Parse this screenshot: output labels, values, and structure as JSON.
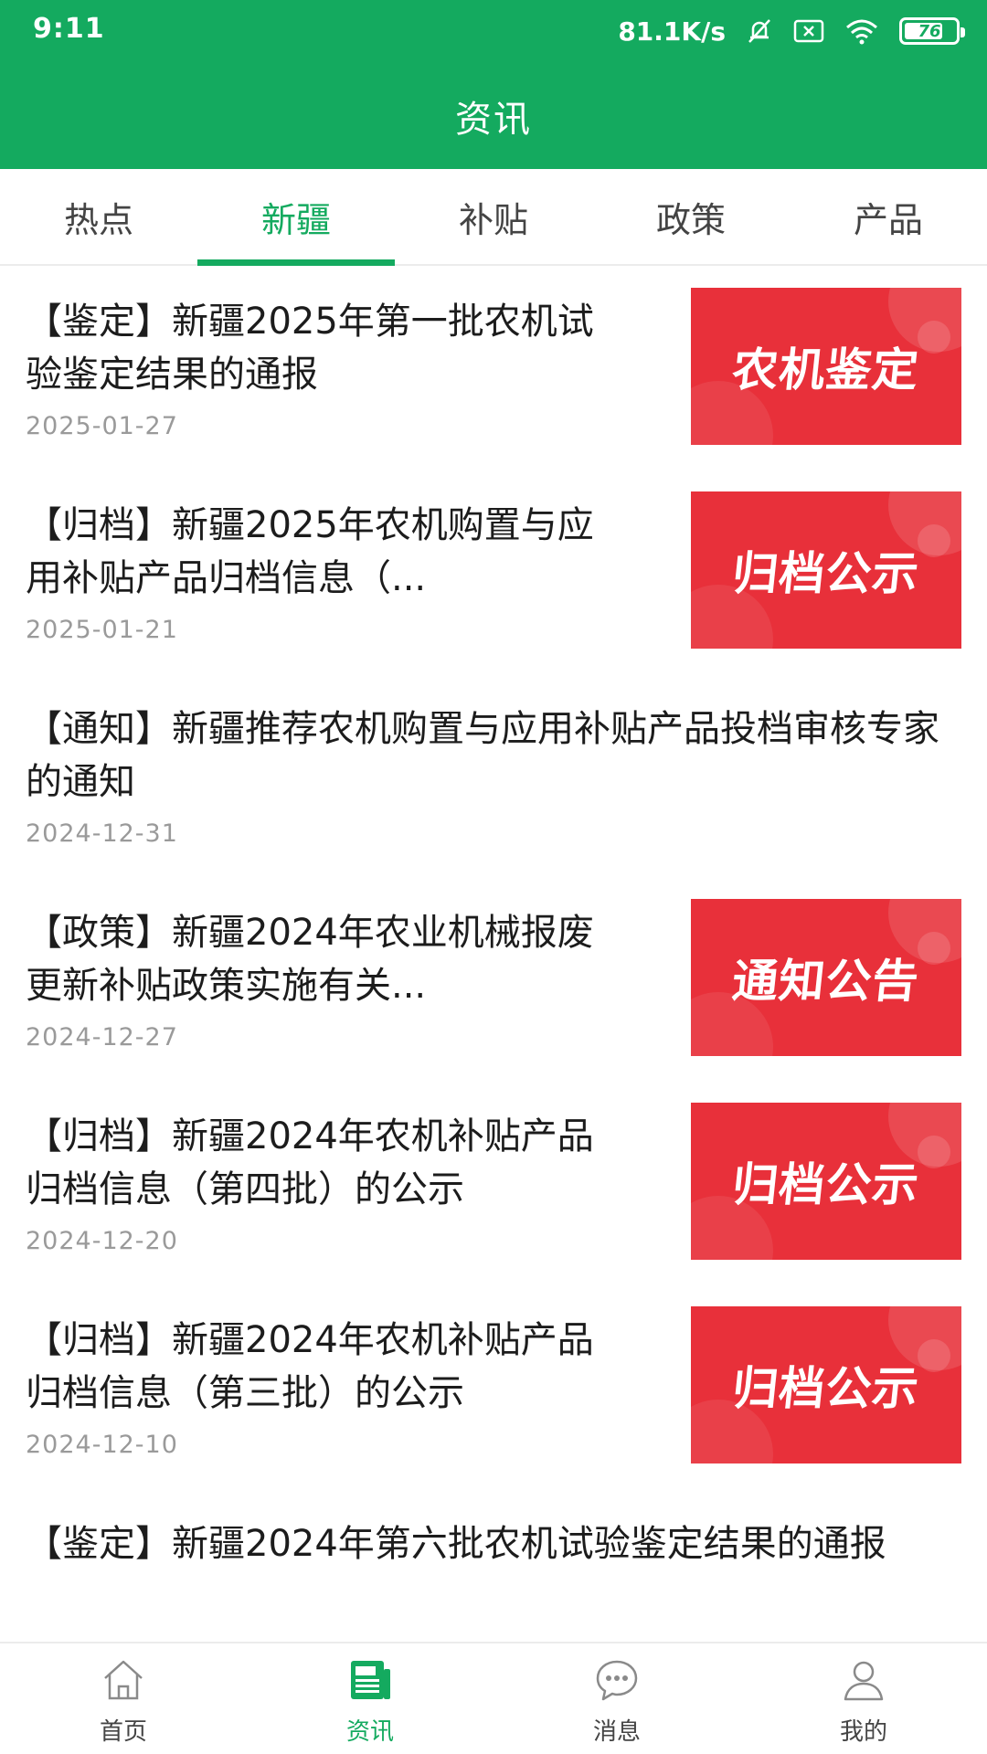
{
  "status_bar": {
    "time": "9:11",
    "network_speed": "81.1K/s",
    "battery_level": "76",
    "battery_fraction": 0.76,
    "icons": [
      "mute-icon",
      "sim-icon",
      "wifi-icon",
      "battery-icon"
    ]
  },
  "header": {
    "title": "资讯"
  },
  "tabs": [
    {
      "label": "热点",
      "active": false
    },
    {
      "label": "新疆",
      "active": true
    },
    {
      "label": "补贴",
      "active": false
    },
    {
      "label": "政策",
      "active": false
    },
    {
      "label": "产品",
      "active": false
    }
  ],
  "news": [
    {
      "title": "【鉴定】新疆2025年第一批农机试验鉴定结果的通报",
      "date": "2025-01-27",
      "thumbnail_text": "农机鉴定"
    },
    {
      "title": "【归档】新疆2025年农机购置与应用补贴产品归档信息（...",
      "date": "2025-01-21",
      "thumbnail_text": "归档公示"
    },
    {
      "title": "【通知】新疆推荐农机购置与应用补贴产品投档审核专家的通知",
      "date": "2024-12-31",
      "thumbnail_text": ""
    },
    {
      "title": "【政策】新疆2024年农业机械报废更新补贴政策实施有关...",
      "date": "2024-12-27",
      "thumbnail_text": "通知公告"
    },
    {
      "title": "【归档】新疆2024年农机补贴产品归档信息（第四批）的公示",
      "date": "2024-12-20",
      "thumbnail_text": "归档公示"
    },
    {
      "title": "【归档】新疆2024年农机补贴产品归档信息（第三批）的公示",
      "date": "2024-12-10",
      "thumbnail_text": "归档公示"
    },
    {
      "title": "【鉴定】新疆2024年第六批农机试验鉴定结果的通报",
      "date": "",
      "thumbnail_text": ""
    }
  ],
  "bottom_nav": [
    {
      "label": "首页",
      "icon": "home-icon",
      "active": false
    },
    {
      "label": "资讯",
      "icon": "news-icon",
      "active": true
    },
    {
      "label": "消息",
      "icon": "message-icon",
      "active": false
    },
    {
      "label": "我的",
      "icon": "profile-icon",
      "active": false
    }
  ],
  "colors": {
    "brand_green": "#14aa5f",
    "thumbnail_red": "#e8303a",
    "date_gray": "#9a9a9a"
  }
}
